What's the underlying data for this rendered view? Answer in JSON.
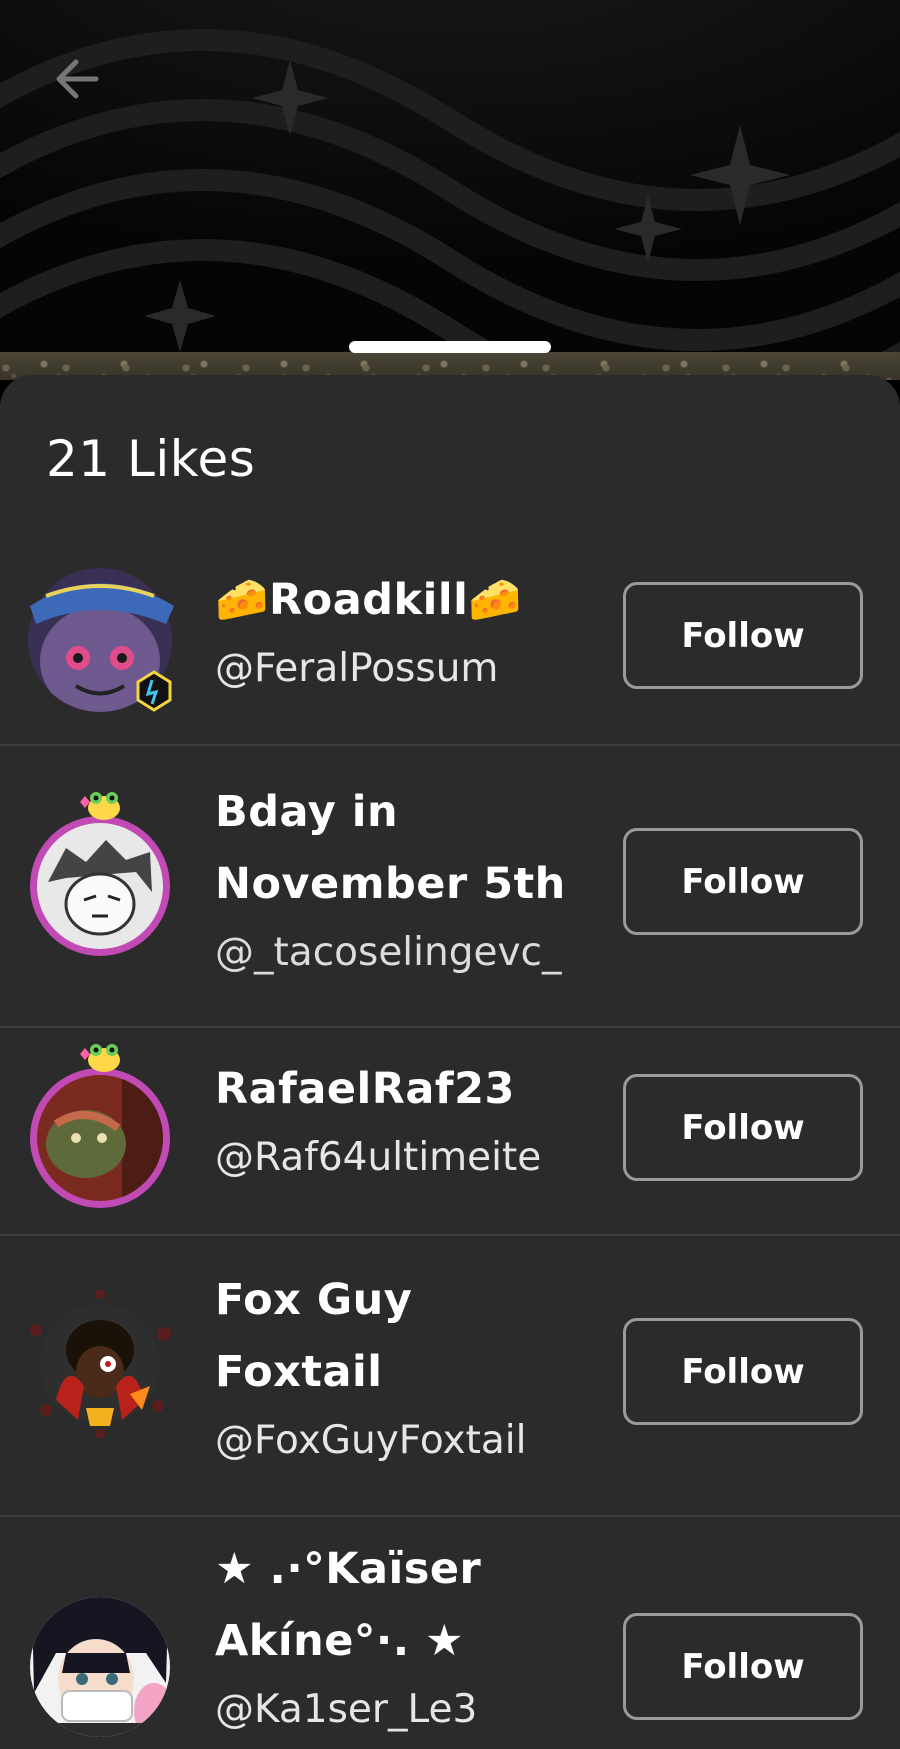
{
  "header": {
    "back_icon": "arrow-left-icon"
  },
  "sheet": {
    "title": "21 Likes"
  },
  "users": [
    {
      "display_name": "🧀Roadkill🧀",
      "handle": "@FeralPossum",
      "follow_label": "Follow"
    },
    {
      "display_name": "Bday in November 5th",
      "handle": "@_tacoselingevc_",
      "follow_label": "Follow"
    },
    {
      "display_name": "RafaelRaf23",
      "handle": "@Raf64ultimeite",
      "follow_label": "Follow"
    },
    {
      "display_name": "Fox Guy Foxtail",
      "handle": "@FoxGuyFoxtail",
      "follow_label": "Follow"
    },
    {
      "display_name": "★ .·°Kaïser Akíne°·. ★",
      "handle": "@Ka1ser_Le3",
      "follow_label": "Follow"
    }
  ]
}
